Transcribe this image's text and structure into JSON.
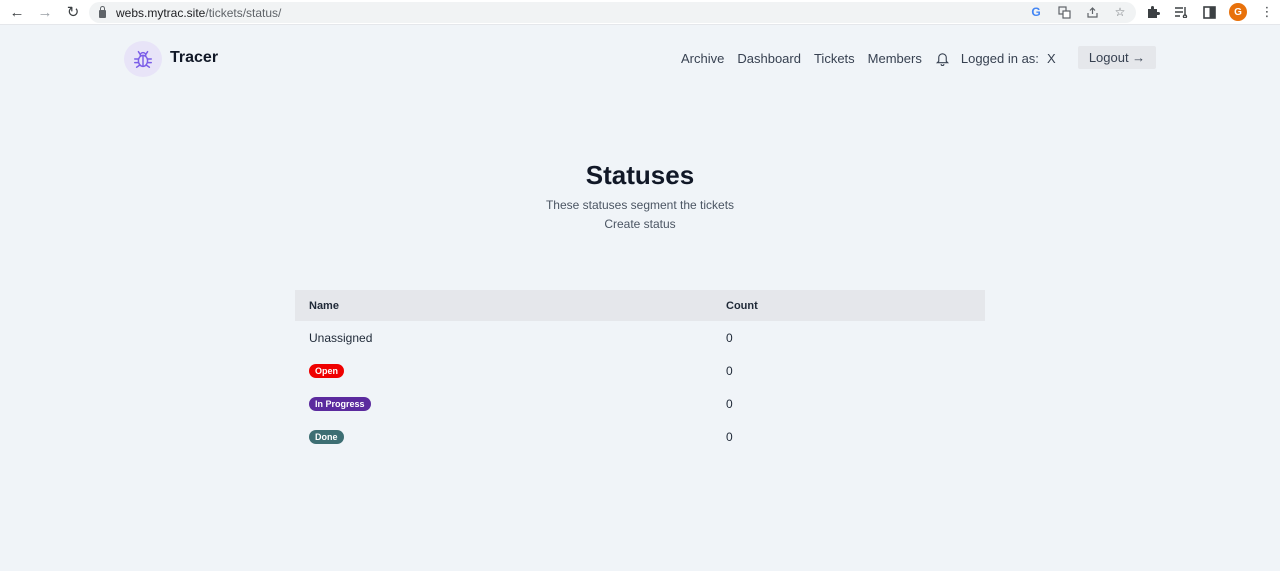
{
  "browser": {
    "url_host": "webs.mytrac.site",
    "url_path": "/tickets/status/",
    "profile_initial": "G"
  },
  "app": {
    "brand": "Tracer",
    "nav": [
      "Archive",
      "Dashboard",
      "Tickets",
      "Members"
    ],
    "logged_in_label": "Logged in as:",
    "logged_in_user": "X",
    "logout_label": "Logout →"
  },
  "page": {
    "title": "Statuses",
    "subtitle": "These statuses segment the tickets",
    "create_link": "Create status"
  },
  "table": {
    "headers": [
      "Name",
      "Count"
    ],
    "rows": [
      {
        "name": "Unassigned",
        "count": "0",
        "badge": false,
        "color": ""
      },
      {
        "name": "Open",
        "count": "0",
        "badge": true,
        "color": "#ef0000"
      },
      {
        "name": "In Progress",
        "count": "0",
        "badge": true,
        "color": "#5b2a9e"
      },
      {
        "name": "Done",
        "count": "0",
        "badge": true,
        "color": "#3d6e73"
      }
    ]
  }
}
